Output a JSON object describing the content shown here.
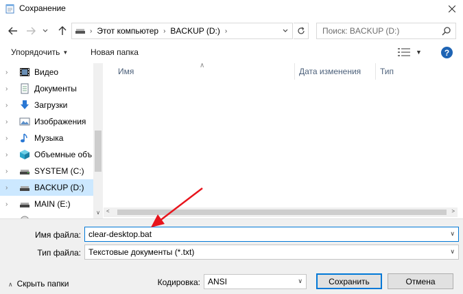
{
  "window": {
    "title": "Сохранение"
  },
  "address": {
    "segments": [
      "Этот компьютер",
      "BACKUP (D:)"
    ]
  },
  "search": {
    "placeholder": "Поиск: BACKUP (D:)"
  },
  "toolbar": {
    "organize": "Упорядочить",
    "new_folder": "Новая папка"
  },
  "tree": {
    "items": [
      {
        "label": "Видео",
        "icon": "video-folder-icon"
      },
      {
        "label": "Документы",
        "icon": "documents-folder-icon"
      },
      {
        "label": "Загрузки",
        "icon": "downloads-folder-icon"
      },
      {
        "label": "Изображения",
        "icon": "pictures-folder-icon"
      },
      {
        "label": "Музыка",
        "icon": "music-folder-icon"
      },
      {
        "label": "Объемные объ",
        "icon": "3d-objects-icon"
      },
      {
        "label": "SYSTEM (C:)",
        "icon": "drive-icon"
      },
      {
        "label": "BACKUP (D:)",
        "icon": "drive-icon",
        "selected": true
      },
      {
        "label": "MAIN (E:)",
        "icon": "drive-icon"
      }
    ]
  },
  "columns": {
    "name": "Имя",
    "date": "Дата изменения",
    "type": "Тип"
  },
  "form": {
    "filename_label": "Имя файла:",
    "filename_value": "clear-desktop.bat",
    "filetype_label": "Тип файла:",
    "filetype_value": "Текстовые документы (*.txt)",
    "encoding_label": "Кодировка:",
    "encoding_value": "ANSI"
  },
  "buttons": {
    "hide_folders": "Скрыть папки",
    "save": "Сохранить",
    "cancel": "Отмена"
  },
  "colors": {
    "accent": "#0078d7",
    "selection": "#cce8ff",
    "annotation_arrow": "#e8141c"
  }
}
